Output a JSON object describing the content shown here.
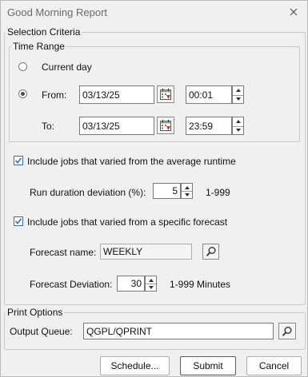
{
  "window": {
    "title": "Good Morning Report"
  },
  "selection": {
    "legend": "Selection Criteria",
    "time_range": {
      "legend": "Time Range",
      "current_day_label": "Current day",
      "from_label": "From:",
      "to_label": "To:",
      "from_date": "03/13/25",
      "from_time": "00:01",
      "to_date": "03/13/25",
      "to_time": "23:59",
      "selected": "from"
    },
    "runtime": {
      "checkbox_label": "Include jobs that varied from the average runtime",
      "checked": true,
      "deviation_label": "Run duration deviation (%):",
      "deviation_value": "5",
      "range_text": "1-999"
    },
    "forecast": {
      "checkbox_label": "Include jobs that varied from a specific forecast",
      "checked": true,
      "name_label": "Forecast name:",
      "name_value": "WEEKLY",
      "deviation_label": "Forecast Deviation:",
      "deviation_value": "30",
      "range_text": "1-999 Minutes"
    }
  },
  "print": {
    "legend": "Print Options",
    "queue_label": "Output Queue:",
    "queue_value": "QGPL/QPRINT"
  },
  "buttons": {
    "schedule": "Schedule...",
    "submit": "Submit",
    "cancel": "Cancel"
  },
  "icons": {
    "calendar": "calendar-icon",
    "search": "magnifier-icon",
    "close": "close-icon"
  },
  "colors": {
    "calendar_accent": "#c0392b",
    "checkbox_blue": "#3b6ea5"
  }
}
